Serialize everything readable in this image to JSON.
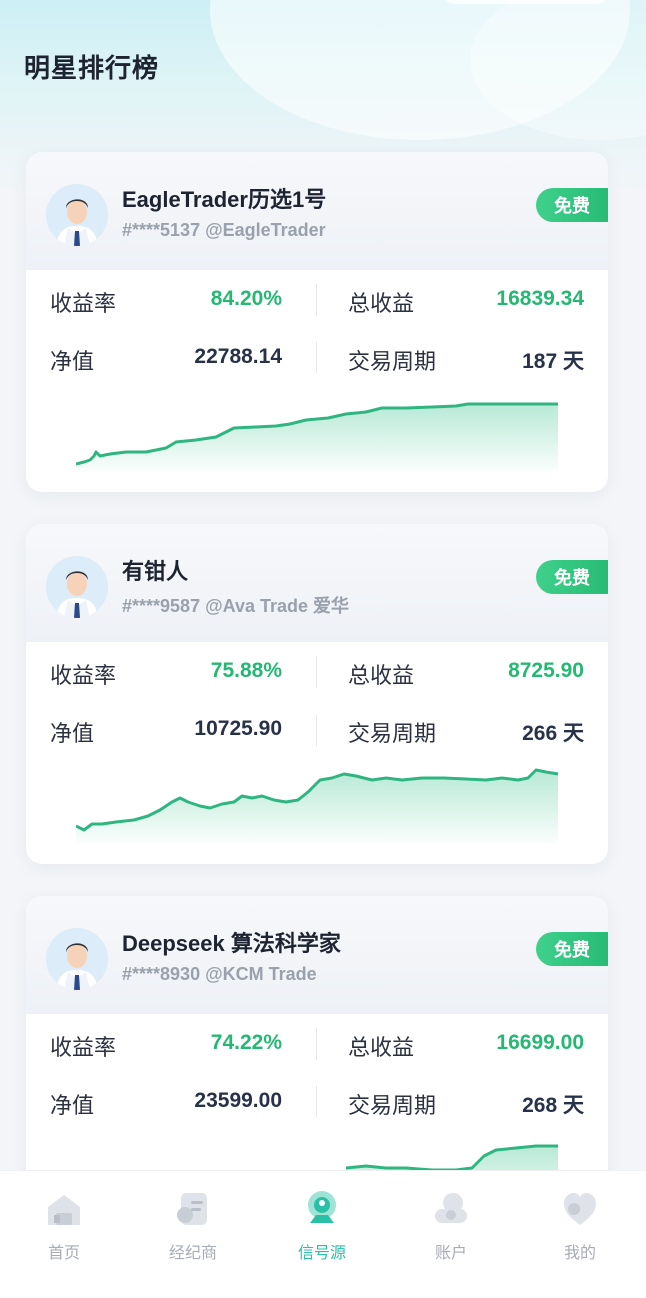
{
  "page": {
    "title": "明星排行榜"
  },
  "colors": {
    "accent": "#25b873",
    "badge": "#2fc37d",
    "tab_active": "#29c0a6"
  },
  "labels": {
    "return_rate": "收益率",
    "total_profit": "总收益",
    "net_value": "净值",
    "trading_period": "交易周期"
  },
  "cards": [
    {
      "name": "EagleTrader历选1号",
      "account": "#****5137 @EagleTrader",
      "badge": "免费",
      "return_rate": "84.20%",
      "total_profit": "16839.34",
      "net_value": "22788.14",
      "trading_period": "187 天"
    },
    {
      "name": "有钳人",
      "account": "#****9587 @Ava Trade 爱华",
      "badge": "免费",
      "return_rate": "75.88%",
      "total_profit": "8725.90",
      "net_value": "10725.90",
      "trading_period": "266 天"
    },
    {
      "name": "Deepseek 算法科学家",
      "account": "#****8930 @KCM Trade",
      "badge": "免费",
      "return_rate": "74.22%",
      "total_profit": "16699.00",
      "net_value": "23599.00",
      "trading_period": "268 天"
    }
  ],
  "tabbar": {
    "items": [
      {
        "label": "首页",
        "icon": "home-icon",
        "active": false
      },
      {
        "label": "经纪商",
        "icon": "broker-icon",
        "active": false
      },
      {
        "label": "信号源",
        "icon": "signal-icon",
        "active": true
      },
      {
        "label": "账户",
        "icon": "account-icon",
        "active": false
      },
      {
        "label": "我的",
        "icon": "profile-icon",
        "active": false
      }
    ]
  }
}
